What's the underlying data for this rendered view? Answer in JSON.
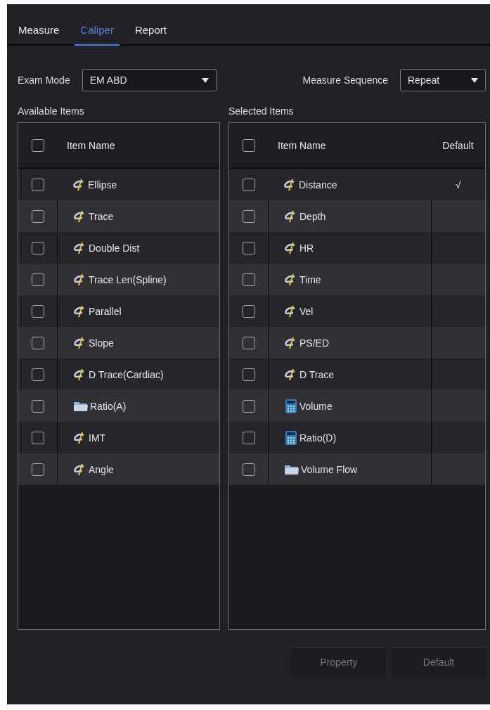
{
  "tabs": [
    {
      "label": "Measure",
      "selected": false
    },
    {
      "label": "Caliper",
      "selected": true
    },
    {
      "label": "Report",
      "selected": false
    }
  ],
  "exam_mode": {
    "label": "Exam Mode",
    "value": "EM ABD"
  },
  "measure_sequence": {
    "label": "Measure Sequence",
    "value": "Repeat"
  },
  "available_items": {
    "title": "Available Items",
    "all_checked": false,
    "columns": [
      "Item Name"
    ],
    "rows": [
      {
        "name": "Ellipse",
        "kind": "caliper",
        "checked": false
      },
      {
        "name": "Trace",
        "kind": "caliper",
        "checked": false
      },
      {
        "name": "Double Dist",
        "kind": "caliper",
        "checked": false
      },
      {
        "name": "Trace Len(Spline)",
        "kind": "caliper",
        "checked": false
      },
      {
        "name": "Parallel",
        "kind": "caliper",
        "checked": false
      },
      {
        "name": "Slope",
        "kind": "caliper",
        "checked": false
      },
      {
        "name": "D Trace(Cardiac)",
        "kind": "caliper",
        "checked": false
      },
      {
        "name": "Ratio(A)",
        "kind": "folder",
        "checked": false
      },
      {
        "name": "IMT",
        "kind": "caliper",
        "checked": false
      },
      {
        "name": "Angle",
        "kind": "caliper",
        "checked": false
      }
    ]
  },
  "selected_items": {
    "title": "Selected Items",
    "all_checked": false,
    "columns": [
      "Item Name",
      "Default"
    ],
    "rows": [
      {
        "name": "Distance",
        "kind": "caliper",
        "checked": false,
        "default": "√"
      },
      {
        "name": "Depth",
        "kind": "caliper",
        "checked": false
      },
      {
        "name": "HR",
        "kind": "caliper",
        "checked": false
      },
      {
        "name": "Time",
        "kind": "caliper",
        "checked": false
      },
      {
        "name": "Vel",
        "kind": "caliper",
        "checked": false
      },
      {
        "name": "PS/ED",
        "kind": "caliper",
        "checked": false
      },
      {
        "name": "D Trace",
        "kind": "caliper",
        "checked": false
      },
      {
        "name": "Volume",
        "kind": "calculator",
        "checked": false
      },
      {
        "name": "Ratio(D)",
        "kind": "calculator",
        "checked": false
      },
      {
        "name": "Volume Flow",
        "kind": "folder",
        "checked": false
      }
    ]
  },
  "buttons": [
    {
      "label": "Property",
      "disabled": true
    },
    {
      "label": "Default",
      "disabled": true
    }
  ]
}
